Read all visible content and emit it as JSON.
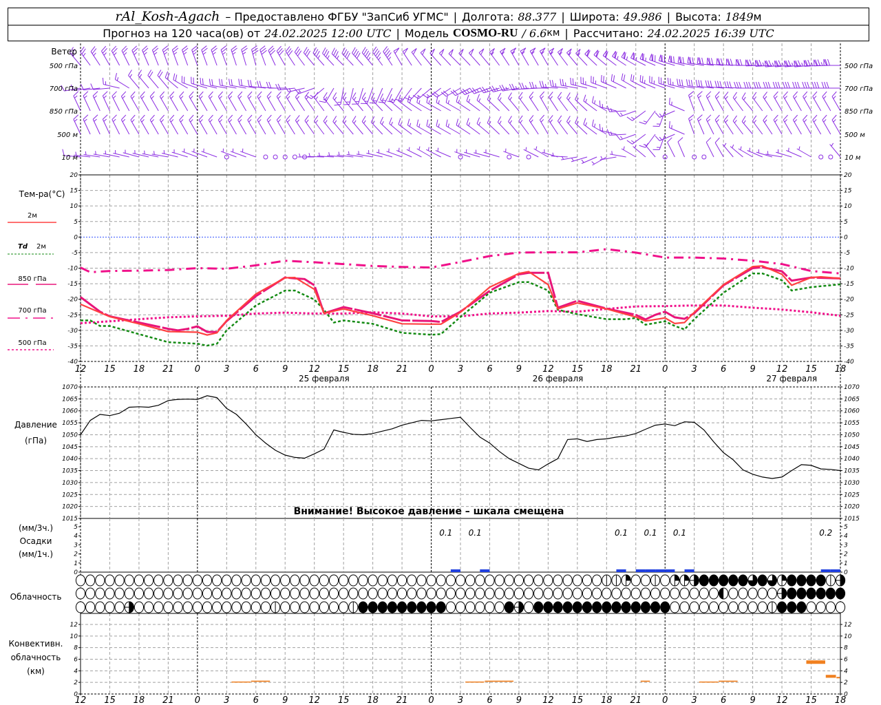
{
  "header": {
    "station": "rAl_Kosh-Agach",
    "provided": "– Предоставлено ФГБУ \"ЗапСиб УГМС\"",
    "lon_label": "Долгота:",
    "lon": "88.377",
    "lat_label": "Широта:",
    "lat": "49.986",
    "alt_label": "Высота:",
    "alt": "1849",
    "alt_unit": "м",
    "forecast_label": "Прогноз на 120 часа(ов) от",
    "forecast_time": "24.02.2025 12:00 UTC",
    "model_label": "Модель",
    "model": "COSMO-RU",
    "res": "/ 6.6",
    "res_unit": "км",
    "calc_label": "Рассчитано:",
    "calc_time": "24.02.2025 16:39 UTC",
    "separator": "|"
  },
  "colors": {
    "t2m": "#ff4040",
    "td": "#138a13",
    "p850": "#e8157a",
    "p700": "#f0108a",
    "p500": "#f0108a",
    "wind": "#8a2be2",
    "zero": "#3050ff",
    "precip": "#2040e0",
    "conv": "#f08020"
  },
  "x_axis": {
    "hour_ticks": [
      "12",
      "15",
      "18",
      "21",
      "0",
      "3",
      "6",
      "9",
      "12",
      "15",
      "18",
      "21",
      "0",
      "3",
      "6",
      "9",
      "12",
      "15",
      "18",
      "21",
      "0",
      "3",
      "6",
      "9",
      "12",
      "15",
      "18"
    ],
    "days": [
      {
        "label": "25 февраля",
        "hour": 25
      },
      {
        "label": "26 февраля",
        "hour": 49
      },
      {
        "label": "27 февраля",
        "hour": 73
      }
    ],
    "day_boundaries_hours": [
      12,
      36,
      60
    ]
  },
  "wind": {
    "title": "Ветер",
    "levels": [
      {
        "label": "500 гПа",
        "key": "w500"
      },
      {
        "label": "700 гПа",
        "key": "w700"
      },
      {
        "label": "850 гПа",
        "key": "w850"
      },
      {
        "label": "500 м",
        "key": "w500m"
      },
      {
        "label": "10 м",
        "key": "w10"
      }
    ],
    "step_hours": 3,
    "w500": {
      "dir": [
        320,
        330,
        335,
        340,
        340,
        340,
        345,
        330,
        320,
        315,
        320,
        330,
        320,
        315,
        320,
        330,
        330,
        320,
        310,
        300,
        290,
        280,
        275,
        270,
        265,
        265,
        270
      ],
      "speed": [
        12,
        12,
        12,
        12,
        12,
        13,
        14,
        15,
        16,
        18,
        22,
        24,
        25,
        25,
        26,
        28,
        28,
        28,
        30,
        32,
        34,
        35,
        36,
        36,
        38,
        38,
        36
      ]
    },
    "w700": {
      "dir": [
        260,
        265,
        320,
        320,
        290,
        280,
        280,
        270,
        250,
        190,
        200,
        210,
        230,
        240,
        250,
        260,
        270,
        280,
        290,
        300,
        290,
        280,
        275,
        270,
        270,
        270,
        270
      ],
      "speed": [
        6,
        6,
        8,
        10,
        10,
        10,
        10,
        10,
        8,
        8,
        8,
        8,
        8,
        10,
        12,
        12,
        12,
        12,
        12,
        10,
        12,
        14,
        14,
        14,
        14,
        14,
        16
      ]
    },
    "w850": {
      "dir": [
        335,
        335,
        330,
        330,
        330,
        330,
        330,
        330,
        325,
        320,
        320,
        310,
        300,
        300,
        310,
        320,
        330,
        320,
        300,
        250,
        200,
        340,
        330,
        320,
        330,
        330,
        330
      ],
      "speed": [
        7,
        7,
        7,
        7,
        7,
        7,
        7,
        7,
        7,
        8,
        8,
        8,
        8,
        8,
        8,
        7,
        7,
        7,
        7,
        7,
        7,
        7,
        8,
        8,
        8,
        8,
        8
      ]
    },
    "w500m": {
      "dir": [
        335,
        335,
        330,
        330,
        330,
        330,
        330,
        330,
        325,
        320,
        320,
        310,
        300,
        300,
        310,
        320,
        330,
        320,
        300,
        250,
        200,
        340,
        330,
        320,
        330,
        330,
        330
      ],
      "speed": [
        7,
        7,
        7,
        7,
        7,
        7,
        7,
        7,
        7,
        8,
        8,
        8,
        8,
        8,
        8,
        7,
        7,
        7,
        7,
        7,
        7,
        7,
        8,
        8,
        8,
        8,
        8
      ]
    },
    "w10": {
      "dir": [
        275,
        280,
        285,
        280,
        290,
        290,
        290,
        280,
        270,
        275,
        280,
        290,
        300,
        290,
        285,
        290,
        300,
        260,
        240,
        300,
        330,
        340,
        330,
        300,
        280,
        300,
        320
      ],
      "speed": [
        4,
        3,
        3,
        3,
        2,
        2,
        2,
        3,
        3,
        3,
        3,
        3,
        3,
        3,
        3,
        3,
        3,
        3,
        3,
        3,
        4,
        4,
        4,
        3,
        3,
        3,
        3
      ],
      "calm_hours": [
        15,
        19,
        20,
        21,
        22,
        23,
        39,
        44,
        46,
        60,
        63,
        64,
        76,
        77
      ]
    }
  },
  "temperature": {
    "title": "Тем-ра(°С)",
    "ylim": [
      -40,
      20
    ],
    "y_ticks": [
      "20",
      "15",
      "10",
      "5",
      "0",
      "-5",
      "-10",
      "-15",
      "-20",
      "-25",
      "-30",
      "-35",
      "-40"
    ],
    "legend": {
      "t2m": "2м",
      "td_sym": "Td",
      "td": "2м",
      "p850": "850 гПа",
      "p700": "700 гПа",
      "p500": "500 гПа"
    },
    "t2m": [
      [
        0,
        -21.6
      ],
      [
        3,
        -25.6
      ],
      [
        6,
        -27.9
      ],
      [
        9,
        -30.4
      ],
      [
        12,
        -30.6
      ],
      [
        13,
        -31.5
      ],
      [
        14,
        -30.8
      ],
      [
        15,
        -26.8
      ],
      [
        18,
        -18.3
      ],
      [
        21,
        -13.1
      ],
      [
        22,
        -13
      ],
      [
        24,
        -16.8
      ],
      [
        25,
        -24.5
      ],
      [
        27,
        -23.1
      ],
      [
        30,
        -25.3
      ],
      [
        33,
        -27.9
      ],
      [
        36,
        -28
      ],
      [
        37,
        -28
      ],
      [
        39,
        -24.2
      ],
      [
        42,
        -16.1
      ],
      [
        45,
        -11.7
      ],
      [
        46,
        -11.1
      ],
      [
        48,
        -15.3
      ],
      [
        49,
        -23.1
      ],
      [
        51,
        -21.2
      ],
      [
        54,
        -23.1
      ],
      [
        57,
        -25.7
      ],
      [
        58,
        -27
      ],
      [
        60,
        -26
      ],
      [
        61,
        -27.8
      ],
      [
        62,
        -27.5
      ],
      [
        63,
        -24.2
      ],
      [
        66,
        -15.3
      ],
      [
        69,
        -9.5
      ],
      [
        70,
        -9.3
      ],
      [
        72,
        -12
      ],
      [
        73,
        -15.5
      ],
      [
        75,
        -13
      ],
      [
        76,
        -12.8
      ],
      [
        78,
        -13.3
      ]
    ],
    "td2m": [
      [
        0,
        -26.8
      ],
      [
        1,
        -26.8
      ],
      [
        2,
        -28.6
      ],
      [
        3,
        -28.6
      ],
      [
        6,
        -31.2
      ],
      [
        9,
        -33.8
      ],
      [
        12,
        -34.3
      ],
      [
        13,
        -34.9
      ],
      [
        14,
        -34.3
      ],
      [
        15,
        -30
      ],
      [
        18,
        -22
      ],
      [
        21,
        -17.2
      ],
      [
        22,
        -17.2
      ],
      [
        24,
        -20.1
      ],
      [
        25,
        -23.4
      ],
      [
        26,
        -27.5
      ],
      [
        27,
        -26.8
      ],
      [
        30,
        -27.9
      ],
      [
        33,
        -30.8
      ],
      [
        36,
        -31.4
      ],
      [
        37,
        -31.2
      ],
      [
        39,
        -25.7
      ],
      [
        42,
        -17.9
      ],
      [
        45,
        -14.5
      ],
      [
        46,
        -14.5
      ],
      [
        48,
        -17.2
      ],
      [
        49,
        -23.4
      ],
      [
        51,
        -24.8
      ],
      [
        54,
        -26.4
      ],
      [
        56,
        -26.4
      ],
      [
        57,
        -26
      ],
      [
        58,
        -28.2
      ],
      [
        60,
        -27.1
      ],
      [
        61,
        -28.6
      ],
      [
        62,
        -29.7
      ],
      [
        63,
        -26.4
      ],
      [
        66,
        -17.9
      ],
      [
        69,
        -11.7
      ],
      [
        70,
        -11.7
      ],
      [
        72,
        -13.9
      ],
      [
        73,
        -17.2
      ],
      [
        75,
        -16.1
      ],
      [
        78,
        -15.2
      ]
    ],
    "t850": [
      [
        0,
        -19.3
      ],
      [
        2,
        -24
      ],
      [
        3,
        -25.5
      ],
      [
        6,
        -27.5
      ],
      [
        9,
        -29.5
      ],
      [
        10,
        -30
      ],
      [
        11,
        -29.5
      ],
      [
        12,
        -28.7
      ],
      [
        13,
        -30.5
      ],
      [
        14,
        -30.5
      ],
      [
        15,
        -27
      ],
      [
        18,
        -19
      ],
      [
        21,
        -13
      ],
      [
        22,
        -13.3
      ],
      [
        23,
        -13.5
      ],
      [
        24,
        -15.5
      ],
      [
        25,
        -24.5
      ],
      [
        27,
        -22.5
      ],
      [
        30,
        -24.5
      ],
      [
        33,
        -26.8
      ],
      [
        36,
        -27
      ],
      [
        37,
        -27.3
      ],
      [
        39,
        -24
      ],
      [
        42,
        -17.3
      ],
      [
        45,
        -12
      ],
      [
        46,
        -11.5
      ],
      [
        48,
        -11.5
      ],
      [
        49,
        -22.7
      ],
      [
        51,
        -20.5
      ],
      [
        54,
        -23
      ],
      [
        57,
        -25
      ],
      [
        58,
        -26.5
      ],
      [
        59,
        -25
      ],
      [
        60,
        -24
      ],
      [
        61,
        -25.8
      ],
      [
        62,
        -26.3
      ],
      [
        63,
        -24.5
      ],
      [
        66,
        -15.5
      ],
      [
        69,
        -10
      ],
      [
        70,
        -9.7
      ],
      [
        72,
        -11
      ],
      [
        73,
        -14
      ],
      [
        75,
        -13
      ],
      [
        78,
        -13.3
      ]
    ],
    "t700": [
      [
        0,
        -9.8
      ],
      [
        1,
        -11.3
      ],
      [
        3,
        -10.9
      ],
      [
        6,
        -10.8
      ],
      [
        9,
        -10.6
      ],
      [
        12,
        -10
      ],
      [
        15,
        -10.2
      ],
      [
        18,
        -9.1
      ],
      [
        21,
        -7.6
      ],
      [
        24,
        -8.1
      ],
      [
        27,
        -8.7
      ],
      [
        30,
        -9.3
      ],
      [
        33,
        -9.6
      ],
      [
        36,
        -9.8
      ],
      [
        39,
        -8
      ],
      [
        42,
        -6.1
      ],
      [
        45,
        -5
      ],
      [
        48,
        -4.9
      ],
      [
        51,
        -4.9
      ],
      [
        54,
        -3.9
      ],
      [
        57,
        -5
      ],
      [
        60,
        -6.6
      ],
      [
        63,
        -6.6
      ],
      [
        66,
        -6.9
      ],
      [
        69,
        -7.6
      ],
      [
        72,
        -8.7
      ],
      [
        75,
        -10.9
      ],
      [
        78,
        -11.7
      ]
    ],
    "t500": [
      [
        0,
        -27.7
      ],
      [
        3,
        -27.1
      ],
      [
        6,
        -26.4
      ],
      [
        9,
        -25.8
      ],
      [
        12,
        -25.5
      ],
      [
        15,
        -25.3
      ],
      [
        18,
        -24.6
      ],
      [
        21,
        -24.3
      ],
      [
        24,
        -24.6
      ],
      [
        27,
        -24.6
      ],
      [
        30,
        -24.2
      ],
      [
        33,
        -24.6
      ],
      [
        36,
        -25.5
      ],
      [
        39,
        -25.5
      ],
      [
        42,
        -24.6
      ],
      [
        45,
        -24.3
      ],
      [
        48,
        -23.8
      ],
      [
        51,
        -24
      ],
      [
        54,
        -23.1
      ],
      [
        57,
        -22.3
      ],
      [
        60,
        -22.2
      ],
      [
        63,
        -22
      ],
      [
        66,
        -22
      ],
      [
        69,
        -22.7
      ],
      [
        72,
        -23.3
      ],
      [
        75,
        -24.2
      ],
      [
        78,
        -25.3
      ]
    ]
  },
  "pressure": {
    "title": "Давление",
    "unit": "(гПа)",
    "ylim": [
      1015,
      1070
    ],
    "y_ticks": [
      "1070",
      "1065",
      "1060",
      "1055",
      "1050",
      "1045",
      "1040",
      "1035",
      "1030",
      "1025",
      "1020",
      "1015"
    ],
    "warning": "Внимание! Высокое давление – шкала смещена",
    "hourly": [
      1050,
      1056,
      1058.5,
      1058,
      1059,
      1061.5,
      1061.7,
      1061.5,
      1062.3,
      1064.3,
      1064.8,
      1064.9,
      1064.8,
      1066.3,
      1065.5,
      1061,
      1058.5,
      1054.5,
      1050,
      1046.5,
      1043.5,
      1041.5,
      1040.5,
      1040.2,
      1042,
      1044,
      1052,
      1051,
      1050.2,
      1050,
      1050.5,
      1051.5,
      1052.5,
      1054,
      1055,
      1056,
      1055.8,
      1056.3,
      1056.8,
      1057.3,
      1053,
      1049,
      1046.5,
      1043,
      1040,
      1038,
      1036,
      1035.3,
      1037.8,
      1040,
      1048,
      1048.3,
      1047.2,
      1048,
      1048.3,
      1049,
      1049.5,
      1050.5,
      1052.3,
      1054,
      1054.5,
      1053.8,
      1055.4,
      1055.2,
      1052,
      1047,
      1042.5,
      1039.5,
      1035.3,
      1033.5,
      1032.3,
      1031.7,
      1032.3,
      1035,
      1037.5,
      1037.2,
      1035.7,
      1035.5,
      1035
    ]
  },
  "precip": {
    "title": "Осадки",
    "unit3": "(мм/3ч.)",
    "unit1": "(мм/1ч.)",
    "y_ticks": [
      "5",
      "4",
      "3",
      "2",
      "1",
      "0"
    ],
    "hourly": [
      [
        38,
        0.05
      ],
      [
        41,
        0.05
      ],
      [
        55,
        0.05
      ],
      [
        57,
        0.05
      ],
      [
        58,
        0.05
      ],
      [
        59,
        0.05
      ],
      [
        60,
        0.05
      ],
      [
        62,
        0.05
      ],
      [
        76,
        0.1
      ],
      [
        77,
        0.15
      ]
    ],
    "sums3h": [
      {
        "hour": 37.5,
        "label": "0.1"
      },
      {
        "hour": 40.5,
        "label": "0.1"
      },
      {
        "hour": 55.5,
        "label": "0.1"
      },
      {
        "hour": 58.5,
        "label": "0.1"
      },
      {
        "hour": 61.5,
        "label": "0.1"
      },
      {
        "hour": 76.5,
        "label": "0.2"
      }
    ]
  },
  "clouds": {
    "title": "Облачность",
    "legend_codes": {
      "o": "clear",
      "v": "1/8",
      "q": "1/4",
      "h": "1/2",
      "l": "1/2",
      "t": "3/4",
      "f": "overcast"
    },
    "rows": [
      "oooooooooooooooooooooooooooooooooooooooooooooooooooooovvqoovoqqhffffftftqffffvhhlh",
      "oooooooooooooooooooooooooooooooooooooooooooooooooooooooooooooooooolooooohffffff",
      "ooooohoooooooooooooovooooooovfffffffffoooooofhoffffffffffffffoooooooooovfff"
    ]
  },
  "convective": {
    "title1": "Конвективн.",
    "title2": "облачность",
    "unit": "(км)",
    "y_ticks": [
      "12",
      "10",
      "8",
      "6",
      "4",
      "2",
      "0"
    ],
    "ylim": [
      0,
      12
    ],
    "layers": [
      {
        "h0": 15.5,
        "h1": 17.5,
        "base": 2.0,
        "top": 2.15
      },
      {
        "h0": 17.5,
        "h1": 19.5,
        "base": 2.1,
        "top": 2.3
      },
      {
        "h0": 39.5,
        "h1": 41.5,
        "base": 2.0,
        "top": 2.15
      },
      {
        "h0": 41.5,
        "h1": 44.5,
        "base": 2.1,
        "top": 2.3
      },
      {
        "h0": 57.5,
        "h1": 58.5,
        "base": 2.1,
        "top": 2.3
      },
      {
        "h0": 63.5,
        "h1": 65.5,
        "base": 2.0,
        "top": 2.15
      },
      {
        "h0": 65.5,
        "h1": 67.5,
        "base": 2.1,
        "top": 2.3
      },
      {
        "h0": 74.5,
        "h1": 76.5,
        "base": 5.2,
        "top": 5.8
      },
      {
        "h0": 76.5,
        "h1": 77.6,
        "base": 2.8,
        "top": 3.3
      },
      {
        "h0": 77.6,
        "h1": 78,
        "base": 2.7,
        "top": 2.95
      }
    ]
  }
}
